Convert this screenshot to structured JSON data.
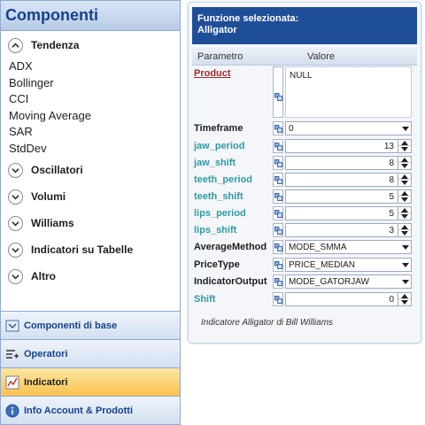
{
  "left_panel": {
    "title": "Componenti",
    "groups": [
      {
        "label": "Tendenza",
        "expanded": true,
        "items": [
          "ADX",
          "Bollinger",
          "CCI",
          "Moving Average",
          "SAR",
          "StdDev"
        ]
      },
      {
        "label": "Oscillatori",
        "expanded": false
      },
      {
        "label": "Volumi",
        "expanded": false
      },
      {
        "label": "Williams",
        "expanded": false
      },
      {
        "label": "Indicatori su Tabelle",
        "expanded": false
      },
      {
        "label": "Altro",
        "expanded": false
      }
    ],
    "nav": [
      {
        "label": "Componenti di base",
        "icon": "component-icon",
        "active": false
      },
      {
        "label": "Operatori",
        "icon": "operators-icon",
        "active": false
      },
      {
        "label": "Indicatori",
        "icon": "chart-icon",
        "active": true
      },
      {
        "label": "Info Account & Prodotti",
        "icon": "info-icon",
        "active": false
      }
    ]
  },
  "right_panel": {
    "header_line1": "Funzione selezionata:",
    "header_line2": "Alligator",
    "col_param": "Parametro",
    "col_value": "Valore",
    "params": [
      {
        "name": "Product",
        "style": "red",
        "kind": "text",
        "value": "NULL"
      },
      {
        "name": "Timeframe",
        "style": "bold",
        "kind": "dropdown",
        "value": "0"
      },
      {
        "name": "jaw_period",
        "style": "teal",
        "kind": "spin",
        "value": "13"
      },
      {
        "name": "jaw_shift",
        "style": "teal",
        "kind": "spin",
        "value": "8"
      },
      {
        "name": "teeth_period",
        "style": "teal",
        "kind": "spin",
        "value": "8"
      },
      {
        "name": "teeth_shift",
        "style": "teal",
        "kind": "spin",
        "value": "5"
      },
      {
        "name": "lips_period",
        "style": "teal",
        "kind": "spin",
        "value": "5"
      },
      {
        "name": "lips_shift",
        "style": "teal",
        "kind": "spin",
        "value": "3"
      },
      {
        "name": "AverageMethod",
        "style": "bold",
        "kind": "dropdown",
        "value": "MODE_SMMA"
      },
      {
        "name": "PriceType",
        "style": "bold",
        "kind": "dropdown",
        "value": "PRICE_MEDIAN"
      },
      {
        "name": "IndicatorOutput",
        "style": "bold",
        "kind": "dropdown",
        "value": "MODE_GATORJAW"
      },
      {
        "name": "Shift",
        "style": "teal",
        "kind": "spin",
        "value": "0"
      }
    ],
    "description": "Indicatore Alligator di Bill Williams"
  }
}
